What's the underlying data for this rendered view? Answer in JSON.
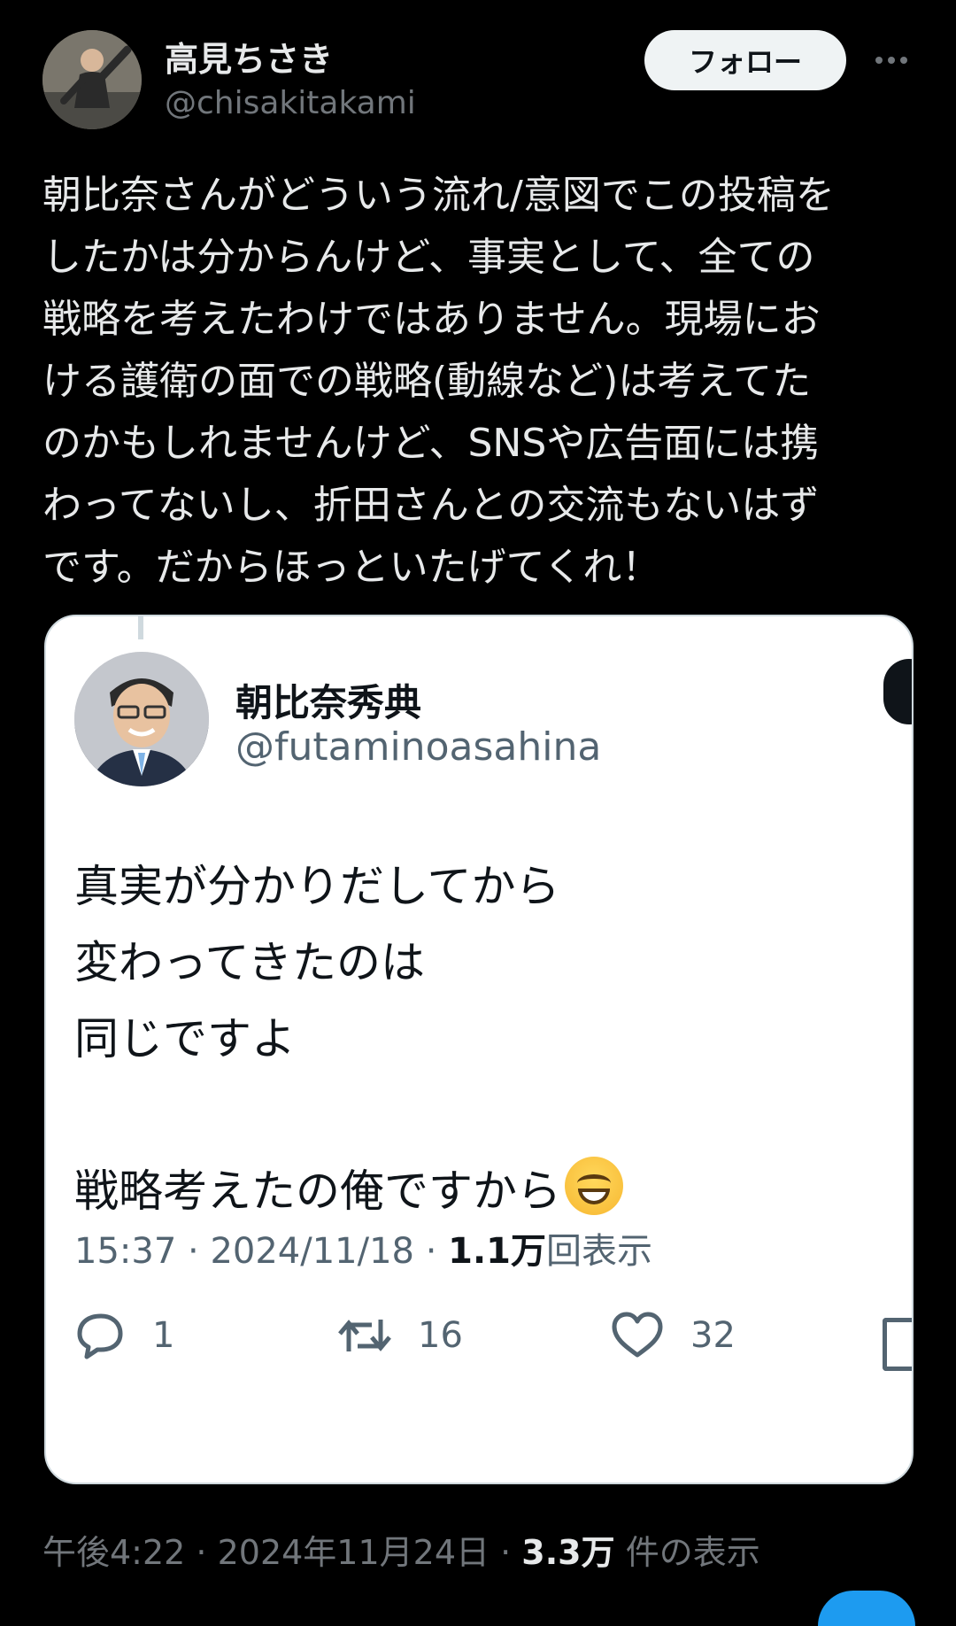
{
  "author": {
    "display_name": "高見ちさき",
    "handle": "@chisakitakami"
  },
  "actions": {
    "follow_label": "フォロー"
  },
  "tweet": {
    "text": "朝比奈さんがどういう流れ/意図でこの投稿を\nしたかは分からんけど、事実として、全ての\n戦略を考えたわけではありません。現場にお\nける護衛の面での戦略(動線など)は考えてた\nのかもしれませんけど、SNSや広告面には携\nわってないし、折田さんとの交流もないはず\nです。だからほっといたげてくれ！"
  },
  "quoted": {
    "display_name": "朝比奈秀典",
    "handle": "@futaminoasahina",
    "text": "真実が分かりだしてから\n変わってきたのは\n同じですよ\n\n戦略考えたの俺ですから",
    "emoji": "grinning-face-with-smiling-eyes",
    "time": "15:37",
    "date": "2024/11/18",
    "views": "1.1万",
    "views_label": "回表示",
    "replies": "1",
    "retweets": "16",
    "likes": "32"
  },
  "footer": {
    "time": "午後4:22",
    "date": "2024年11月24日",
    "views": "3.3万",
    "views_label": "件の表示"
  },
  "icons": {
    "more": "more-horizontal-icon",
    "reply": "reply-bubble-icon",
    "retweet": "retweet-icon",
    "like": "heart-icon",
    "bookmark": "bookmark-icon"
  },
  "colors": {
    "background": "#000000",
    "text": "#e7e9ea",
    "muted": "#71767b",
    "card_bg": "#ffffff",
    "card_text": "#0f1419",
    "card_muted": "#536471",
    "accent": "#1d9bf0"
  }
}
